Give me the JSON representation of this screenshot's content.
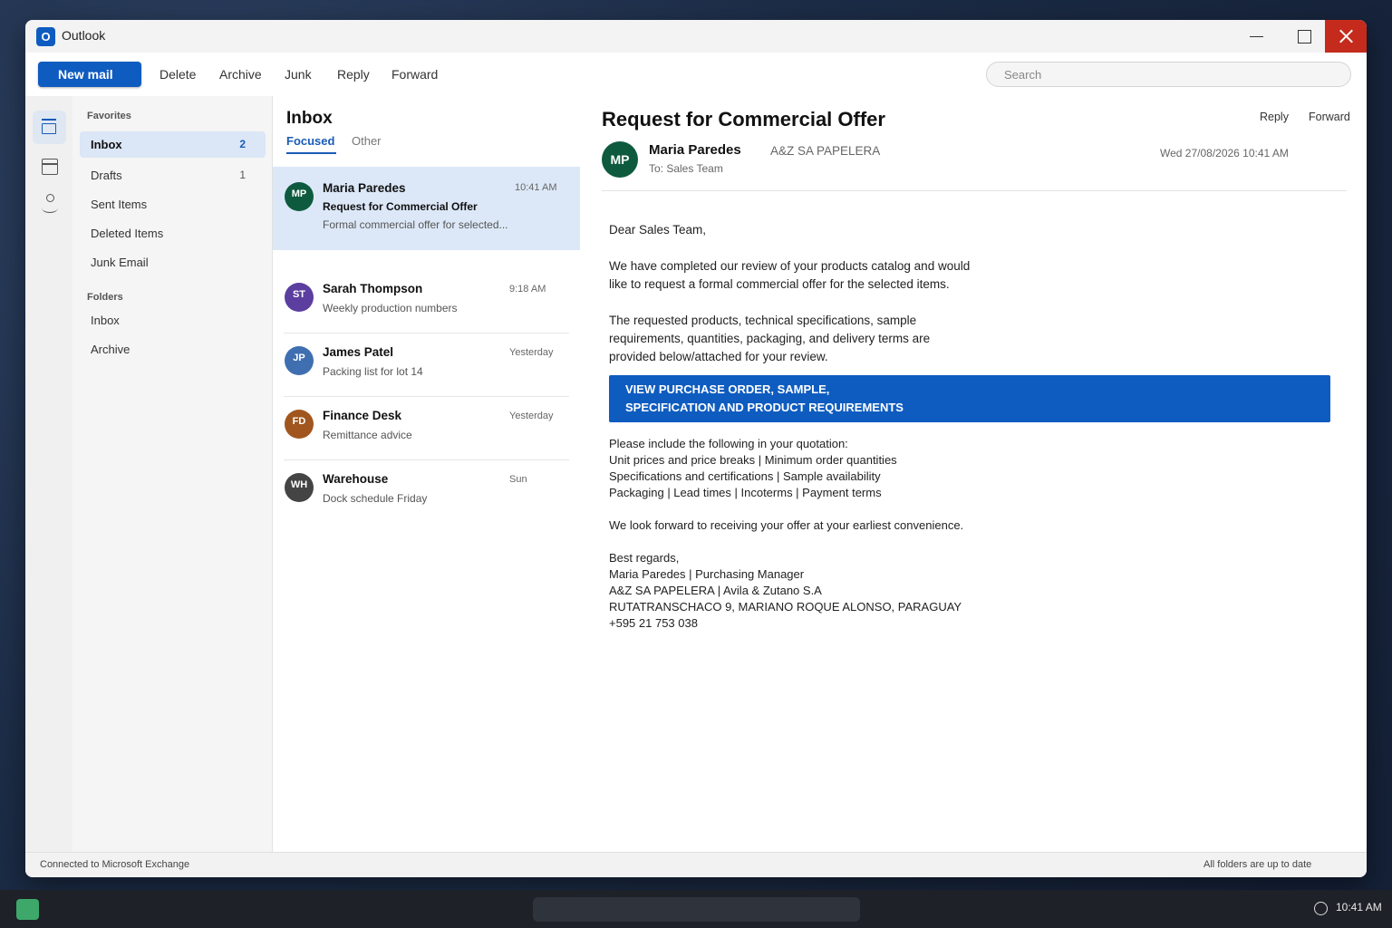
{
  "window": {
    "app_logo_letter": "O",
    "title": "Outlook",
    "accent_color": "#0f5cc0",
    "close_color": "#c42b1c"
  },
  "toolbar": {
    "new_mail": "New mail",
    "actions": [
      "Delete",
      "Archive",
      "Junk",
      "Reply",
      "Forward"
    ],
    "search_placeholder": "Search"
  },
  "rail": {
    "icons": [
      "mail-icon",
      "calendar-icon",
      "people-icon"
    ]
  },
  "folders": {
    "favorites_heading": "Favorites",
    "favorites": [
      {
        "label": "Inbox",
        "count": "2",
        "active": true
      },
      {
        "label": "Drafts",
        "count": "1"
      },
      {
        "label": "Sent Items",
        "count": ""
      },
      {
        "label": "Deleted Items",
        "count": ""
      },
      {
        "label": "Junk Email",
        "count": ""
      }
    ],
    "folders_heading": "Folders",
    "folders": [
      {
        "label": "Inbox"
      },
      {
        "label": "Archive"
      }
    ]
  },
  "message_list": {
    "title": "Inbox",
    "tabs": [
      "Focused",
      "Other"
    ],
    "messages": [
      {
        "initials": "MP",
        "sender": "Maria Paredes",
        "time": "10:41 AM",
        "subject": "Request for Commercial Offer",
        "preview": "Formal commercial offer for selected...",
        "avatar_color": "#0e5a3e",
        "selected": true
      },
      {
        "initials": "ST",
        "sender": "Sarah Thompson",
        "time": "9:18 AM",
        "preview": "Weekly production numbers",
        "avatar_color": "#5b3ea0"
      },
      {
        "initials": "JP",
        "sender": "James Patel",
        "time": "Yesterday",
        "preview": "Packing list for lot 14",
        "avatar_color": "#3f6fb0"
      },
      {
        "initials": "FD",
        "sender": "Finance Desk",
        "time": "Yesterday",
        "preview": "Remittance advice",
        "avatar_color": "#a0561e"
      },
      {
        "initials": "WH",
        "sender": "Warehouse",
        "time": "Sun",
        "preview": "Dock schedule Friday",
        "avatar_color": "#444444"
      }
    ]
  },
  "reading": {
    "subject": "Request for Commercial Offer",
    "actions": [
      "Reply",
      "Forward"
    ],
    "avatar_initials": "MP",
    "sender": "Maria Paredes",
    "org": "A&Z SA PAPELERA",
    "to": "To: Sales Team",
    "date": "Wed 27/08/2026 10:41 AM",
    "body_intro": [
      "Dear Sales Team,",
      "We have completed our review of your products catalog and would",
      "like to request a formal commercial offer for the selected items.",
      "The requested products, technical specifications, sample",
      "requirements, quantities, packaging, and delivery terms are",
      "provided below/attached for your review."
    ],
    "cta_lines": [
      "VIEW PURCHASE ORDER, SAMPLE,",
      "SPECIFICATION AND PRODUCT REQUIREMENTS"
    ],
    "body_list": [
      "Please include the following in your quotation:",
      "Unit prices and price breaks  |  Minimum order quantities",
      "Specifications and certifications  |  Sample availability",
      "Packaging  |  Lead times  |  Incoterms  |  Payment terms"
    ],
    "closing": "We look forward to receiving your offer at your earliest convenience.",
    "signature": [
      "Best regards,",
      "Maria Paredes  |  Purchasing Manager",
      "A&Z SA PAPELERA  |  Avila & Zutano S.A",
      "RUTATRANSCHACO 9, MARIANO ROQUE ALONSO, PARAGUAY",
      "+595 21 753 038"
    ]
  },
  "status": {
    "left": "Connected to Microsoft Exchange",
    "right": "All folders are up to date"
  },
  "taskbar": {
    "clock": "10:41 AM"
  }
}
